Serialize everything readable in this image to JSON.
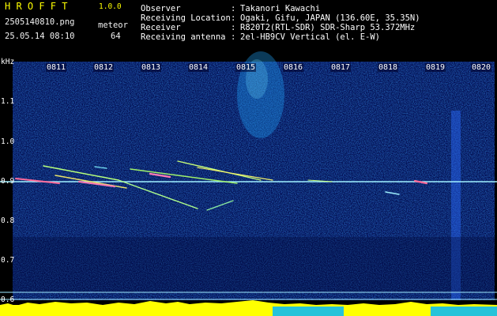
{
  "app": {
    "logo": "H R O F F T",
    "version": "1.0.0"
  },
  "file": {
    "name": "2505140810.png",
    "timestamp": "25.05.14 08:10"
  },
  "counter": {
    "label": "meteor",
    "value": "64"
  },
  "info": [
    {
      "label": "Observer",
      "value": "Takanori Kawachi"
    },
    {
      "label": "Receiving Location",
      "value": "Ogaki, Gifu, JAPAN (136.60E, 35.35N)"
    },
    {
      "label": "Receiver",
      "value": "R820T2(RTL-SDR) SDR-Sharp 53.372MHz"
    },
    {
      "label": "Receiving antenna",
      "value": "2el-HB9CV Vertical (el. E-W)"
    }
  ],
  "axes": {
    "y_unit": "kHz",
    "y_ticks": [
      "1.1",
      "1.0",
      "0.9",
      "0.8",
      "0.7",
      "0.6"
    ],
    "x_ticks": [
      "0811",
      "0812",
      "0813",
      "0814",
      "0815",
      "0816",
      "0817",
      "0818",
      "0819",
      "0820"
    ]
  },
  "colors": {
    "logo": "#ffff00",
    "text": "#ffffff",
    "background": "#000000",
    "baseline": "#ffff00",
    "carrier": "#8fe8ff"
  }
}
